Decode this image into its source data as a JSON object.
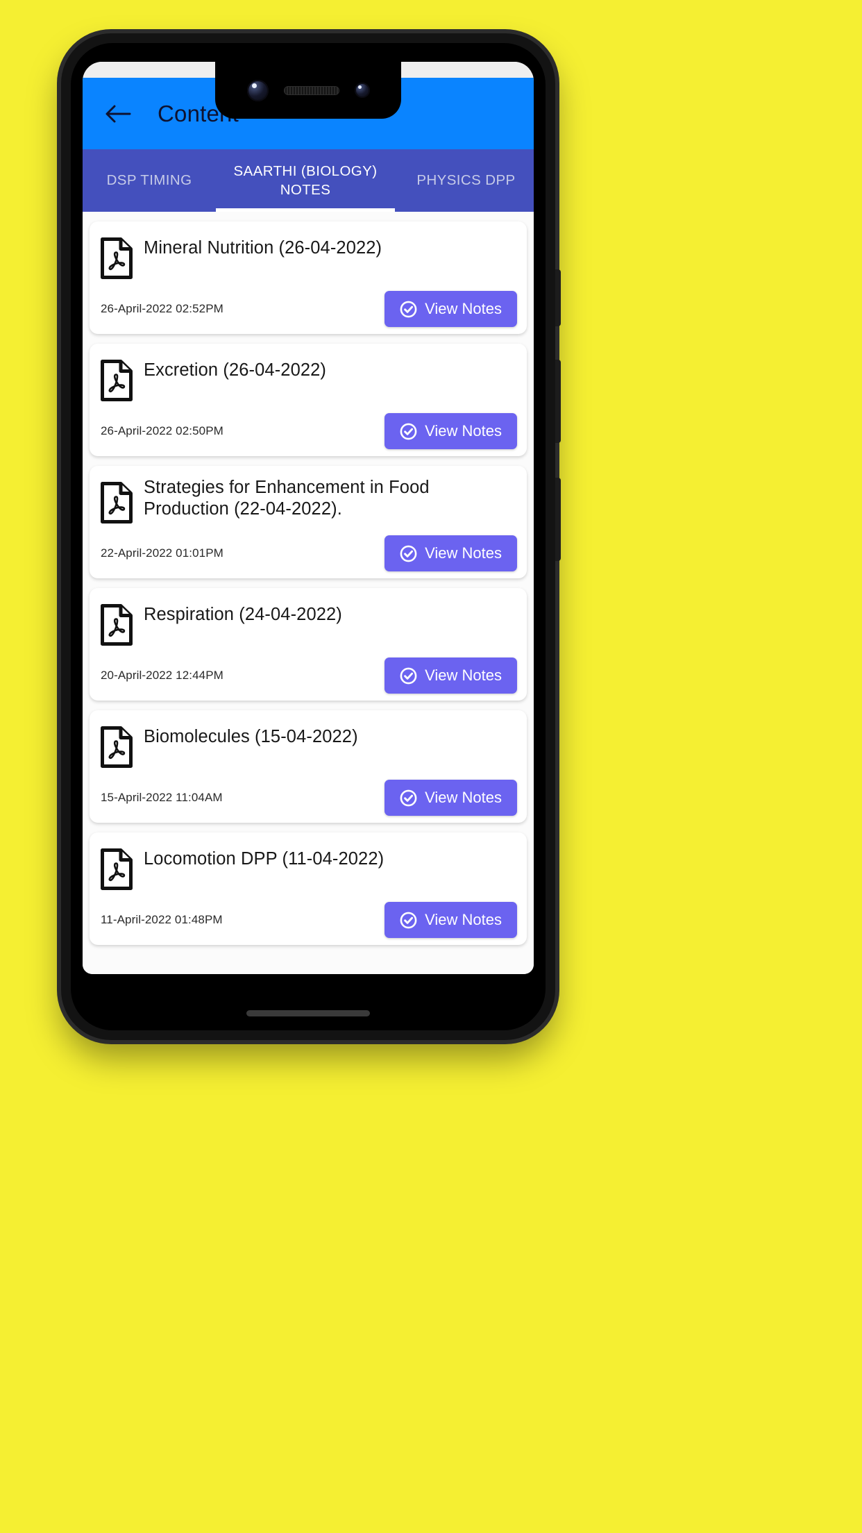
{
  "theme": {
    "page_background": "#F5EF32",
    "appbar_color": "#0A84FF",
    "tabbar_color": "#4450BD",
    "accent_button": "#6B63F0",
    "card_background": "#FFFFFF"
  },
  "appbar": {
    "back_icon": "arrow-left-icon",
    "title": "Content"
  },
  "tabs": [
    {
      "label": "DSP TIMING",
      "active": false
    },
    {
      "label": "SAARTHI (BIOLOGY) NOTES",
      "active": true
    },
    {
      "label": "PHYSICS DPP",
      "active": false
    }
  ],
  "list": {
    "button_label": "View Notes",
    "button_icon": "check-circle-icon",
    "file_icon": "pdf-file-icon",
    "items": [
      {
        "title": "Mineral Nutrition (26-04-2022)",
        "date": "26-April-2022 02:52PM",
        "two_line": false
      },
      {
        "title": "Excretion (26-04-2022)",
        "date": "26-April-2022 02:50PM",
        "two_line": false
      },
      {
        "title": "Strategies for Enhancement in Food Production (22-04-2022).",
        "date": "22-April-2022 01:01PM",
        "two_line": true
      },
      {
        "title": "Respiration (24-04-2022)",
        "date": "20-April-2022 12:44PM",
        "two_line": false
      },
      {
        "title": "Biomolecules (15-04-2022)",
        "date": "15-April-2022 11:04AM",
        "two_line": false
      },
      {
        "title": "Locomotion DPP  (11-04-2022)",
        "date": "11-April-2022 01:48PM",
        "two_line": false
      }
    ]
  }
}
